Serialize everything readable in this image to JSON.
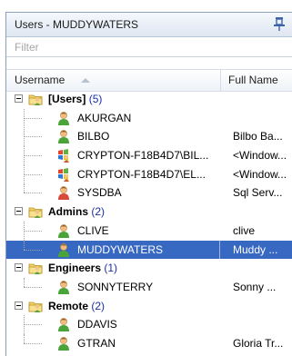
{
  "panel": {
    "title": "Users - MUDDYWATERS",
    "filter_placeholder": "Filter"
  },
  "columns": {
    "username": "Username",
    "full_name": "Full Name"
  },
  "groups": [
    {
      "name": "[Users]",
      "count": "(5)",
      "members": [
        {
          "name": "AKURGAN",
          "full": "",
          "kind": "user"
        },
        {
          "name": "BILBO",
          "full": "Bilbo Ba...",
          "kind": "user"
        },
        {
          "name": "CRYPTON-F18B4D7\\BIL...",
          "full": "<Window...",
          "kind": "windows"
        },
        {
          "name": "CRYPTON-F18B4D7\\EL...",
          "full": "<Window...",
          "kind": "windows"
        },
        {
          "name": "SYSDBA",
          "full": "Sql Serv...",
          "kind": "sysdba"
        }
      ]
    },
    {
      "name": "Admins",
      "count": "(2)",
      "members": [
        {
          "name": "CLIVE",
          "full": "clive",
          "kind": "user"
        },
        {
          "name": "MUDDYWATERS",
          "full": "Muddy ...",
          "kind": "user",
          "selected": true
        }
      ]
    },
    {
      "name": "Engineers",
      "count": "(1)",
      "members": [
        {
          "name": "SONNYTERRY",
          "full": "Sonny ...",
          "kind": "user"
        }
      ]
    },
    {
      "name": "Remote",
      "count": "(2)",
      "members": [
        {
          "name": "DDAVIS",
          "full": "",
          "kind": "user"
        },
        {
          "name": "GTRAN",
          "full": "Gloria Tr...",
          "kind": "user"
        }
      ]
    }
  ]
}
